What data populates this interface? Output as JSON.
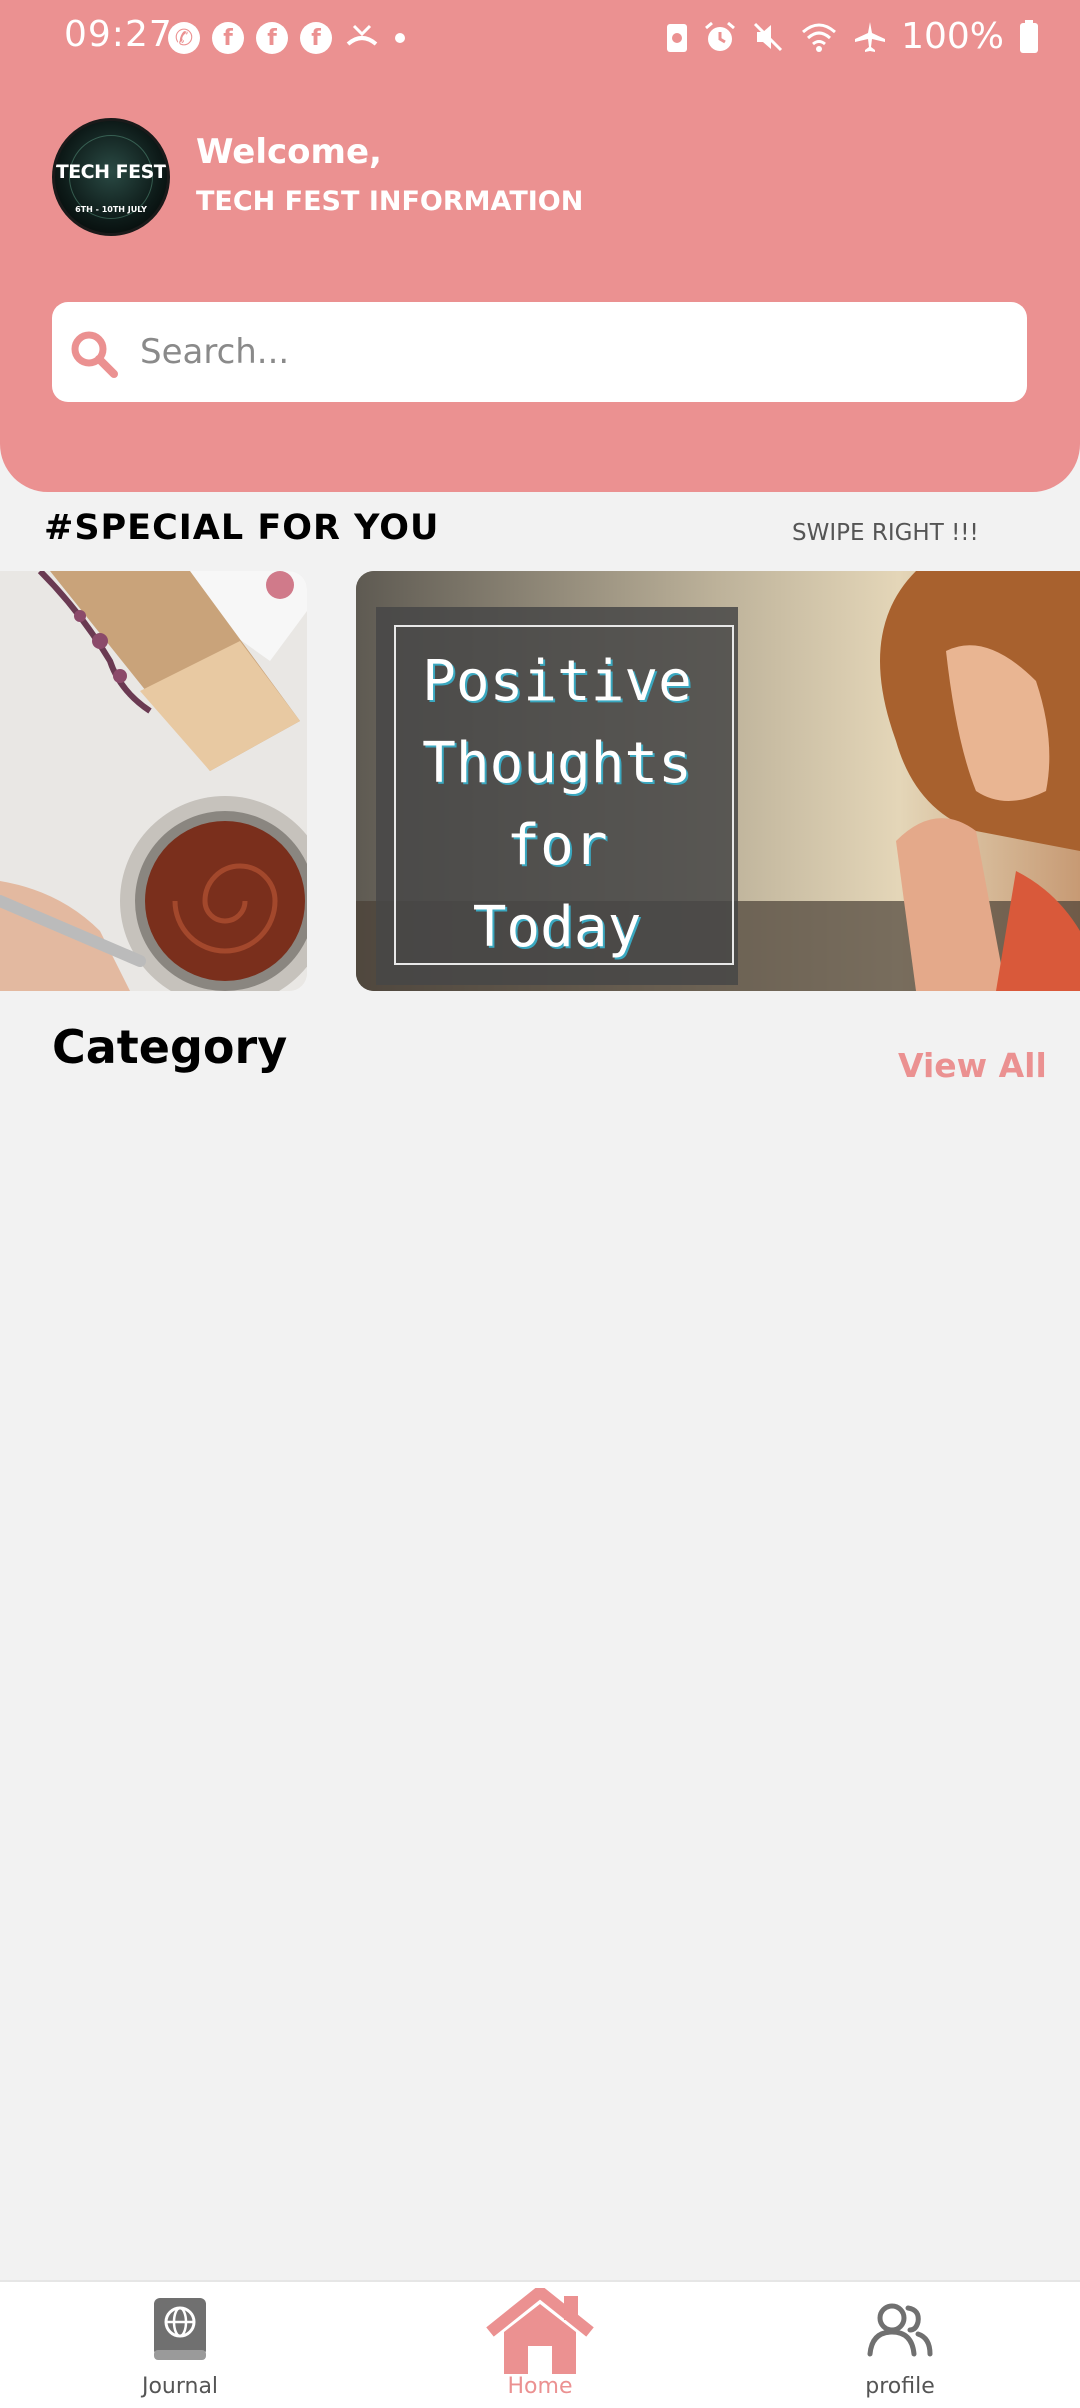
{
  "status_bar": {
    "time": "09:27",
    "battery": "100%"
  },
  "header": {
    "avatar_logo_text": "TECH FEST",
    "avatar_logo_sub": "6TH - 10TH JULY",
    "welcome": "Welcome,",
    "username": "TECH FEST INFORMATION"
  },
  "search": {
    "placeholder": "Search..."
  },
  "special": {
    "title": "#SPECIAL FOR YOU",
    "hint": "SWIPE RIGHT !!!",
    "card_right_text": [
      "Positive",
      "Thoughts",
      "for",
      "Today"
    ]
  },
  "category": {
    "title": "Category",
    "view_all": "View All"
  },
  "nav": {
    "journal": "Journal",
    "home": "Home",
    "profile": "profile"
  },
  "colors": {
    "accent": "#eb9191",
    "background": "#f2f2f2"
  }
}
